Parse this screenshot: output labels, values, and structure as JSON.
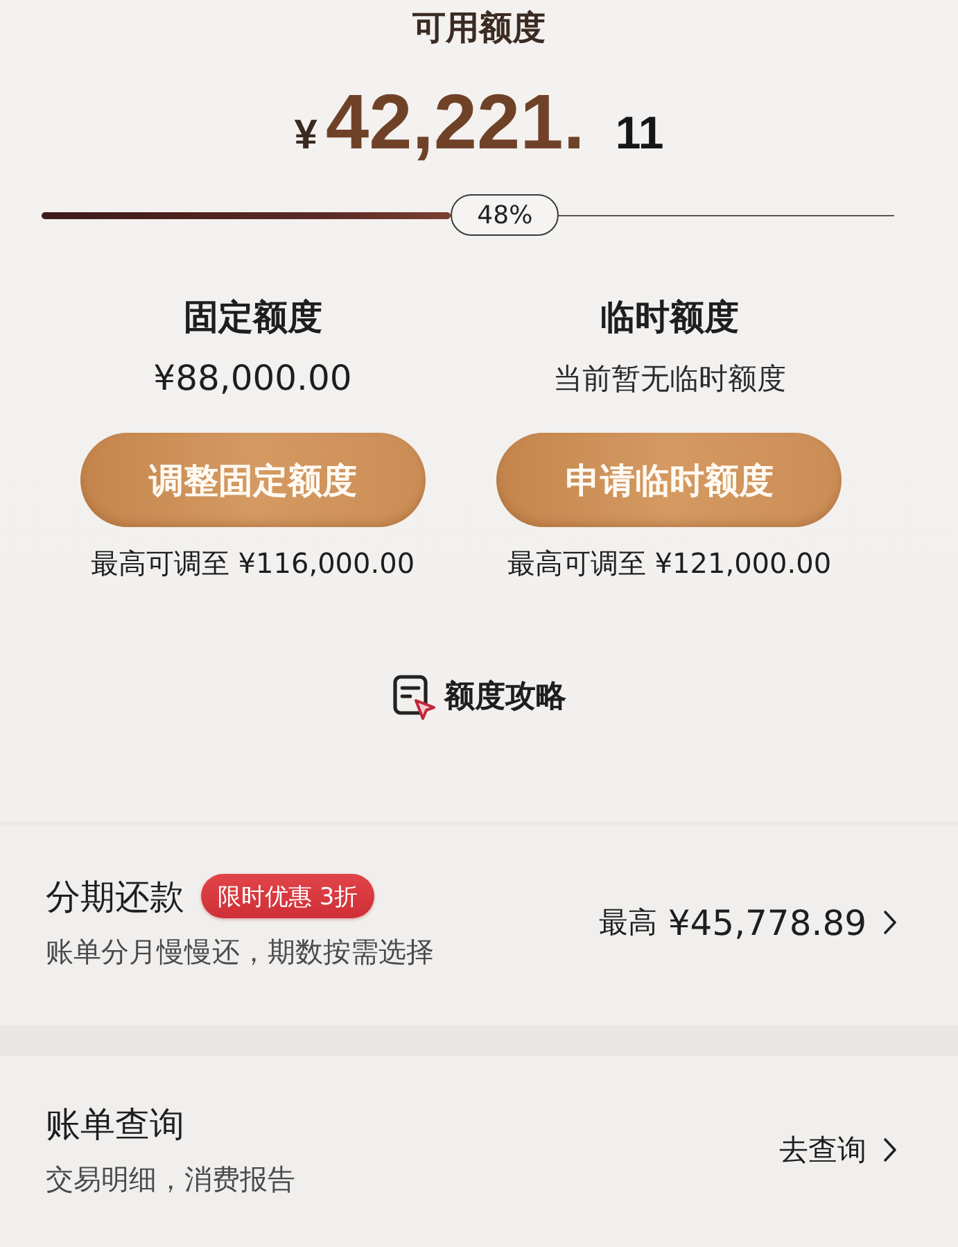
{
  "available": {
    "label": "可用额度",
    "currency": "¥",
    "integer": "42,221.",
    "decimal": "11"
  },
  "usage": {
    "level": 0.48,
    "reading": "48%"
  },
  "limits": [
    {
      "kind": "amount",
      "title": "固定额度",
      "value": "¥88,000.00",
      "button": "调整固定额度",
      "max": "最高可调至 ¥116,000.00"
    },
    {
      "kind": "note",
      "title": "临时额度",
      "value": "当前暂无临时额度",
      "button": "申请临时额度",
      "max": "最高可调至 ¥121,000.00"
    }
  ],
  "guide": {
    "label": "额度攻略"
  },
  "rows": [
    {
      "title": "分期还款",
      "badge": "限时优惠 3折",
      "subtitle": "账单分月慢慢还，期数按需选择",
      "action_label": "最高",
      "action_value": "¥45,778.89"
    },
    {
      "title": "账单查询",
      "subtitle": "交易明细，消费报告",
      "action_label": "去查询"
    }
  ]
}
